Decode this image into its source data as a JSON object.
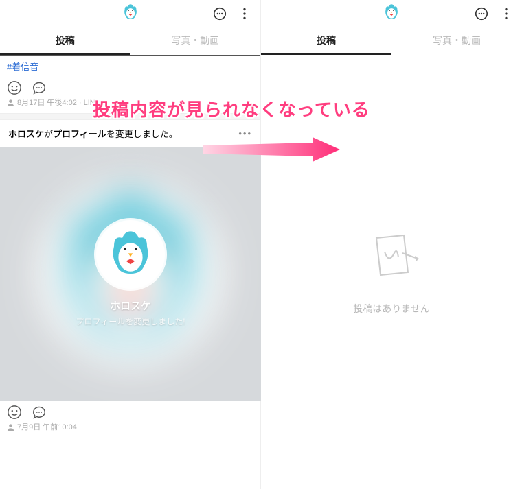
{
  "left": {
    "tabs": {
      "posts": "投稿",
      "media": "写真・動画"
    },
    "hashtag": "#着信音",
    "meta1": "8月17日 午後4:02 · LIN",
    "profile_change": {
      "prefix": "ホロスケ",
      "mid": "がプロフィール",
      "suffix": "を変更しました。"
    },
    "card": {
      "name": "ホロスケ",
      "sub": "プロフィールを変更しました!"
    },
    "meta2": "7月9日 午前10:04"
  },
  "right": {
    "tabs": {
      "posts": "投稿",
      "media": "写真・動画"
    },
    "empty": "投稿はありません"
  },
  "annotation": "投稿内容が見られなくなっている"
}
